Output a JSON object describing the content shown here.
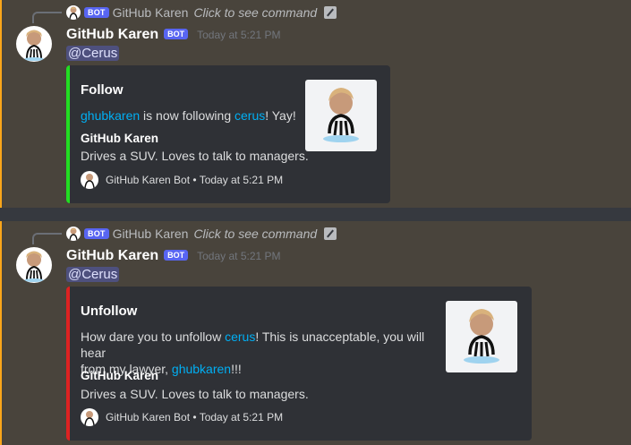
{
  "messages": [
    {
      "reply": {
        "bot_tag": "BOT",
        "name": "GitHub Karen",
        "command": "Click to see command"
      },
      "author": "GitHub Karen",
      "bot_tag": "BOT",
      "timestamp": "Today at 5:21 PM",
      "mention": "@Cerus",
      "embed": {
        "color": "#22dd22",
        "title": "Follow",
        "desc_parts": [
          "ghubkaren",
          " is now following ",
          "cerus",
          "! Yay!"
        ],
        "field_name": "GitHub Karen",
        "field_value": "Drives a SUV. Loves to talk to managers.",
        "footer": "GitHub Karen Bot • Today at 5:21 PM"
      }
    },
    {
      "reply": {
        "bot_tag": "BOT",
        "name": "GitHub Karen",
        "command": "Click to see command"
      },
      "author": "GitHub Karen",
      "bot_tag": "BOT",
      "timestamp": "Today at 5:21 PM",
      "mention": "@Cerus",
      "embed": {
        "color": "#dd2222",
        "title": "Unfollow",
        "desc_parts": [
          "How dare you to unfollow ",
          "cerus",
          "! This is unacceptable, you will hear",
          "from my lawyer, ",
          "ghubkaren",
          "!!!"
        ],
        "field_name": "GitHub Karen",
        "field_value": "Drives a SUV. Loves to talk to managers.",
        "footer": "GitHub Karen Bot • Today at 5:21 PM"
      }
    }
  ],
  "colors": {
    "mention_highlight": "#49443c",
    "mention_border": "#faa61a",
    "bot_tag": "#5865f2",
    "link": "#00aff4"
  },
  "icons": {
    "avatar": "karen-octocat-avatar",
    "command": "slash-command-icon"
  }
}
